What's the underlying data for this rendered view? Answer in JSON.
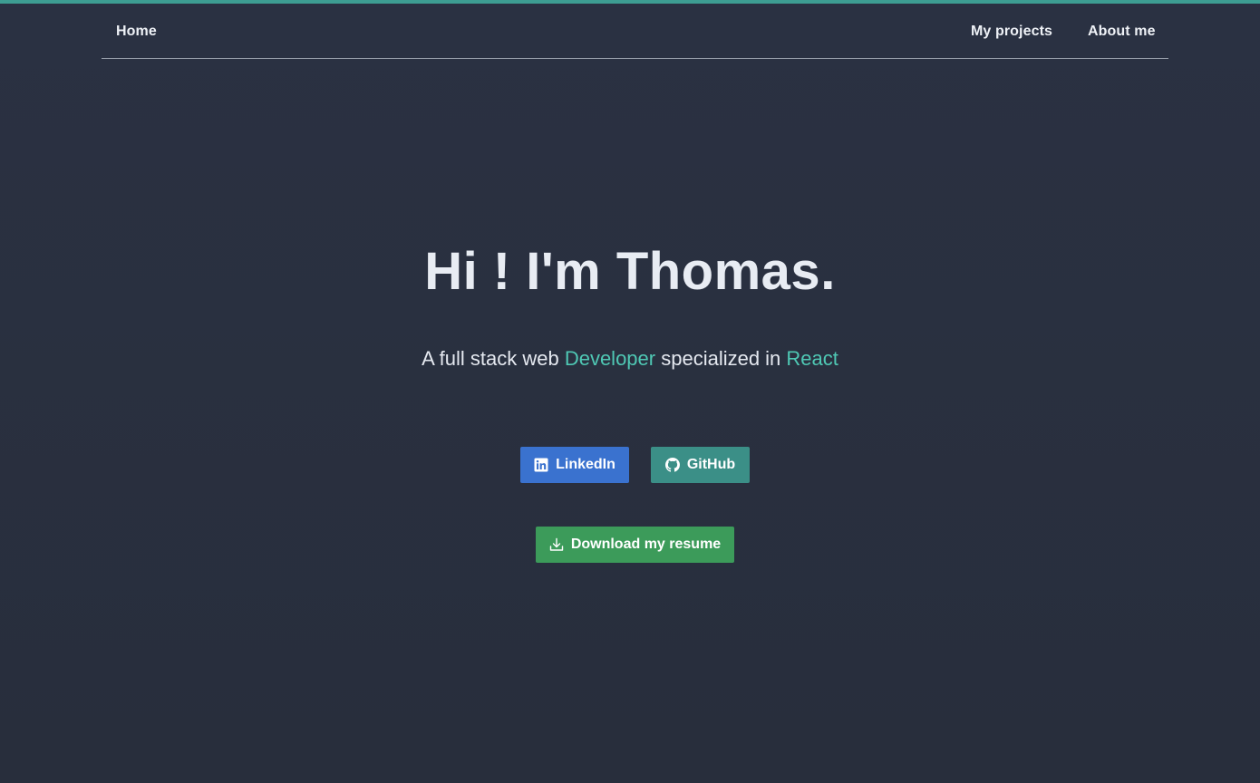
{
  "colors": {
    "background": "#282f3f",
    "accent_bar": "#3d9d92",
    "highlight": "#4fc8b4",
    "linkedin_button": "#3a72cf",
    "github_button": "#3b8f87",
    "resume_button": "#3c9b5a"
  },
  "nav": {
    "home": "Home",
    "projects": "My projects",
    "about": "About me"
  },
  "hero": {
    "title": "Hi ! I'm Thomas.",
    "subtitle_part1": "A full stack web ",
    "subtitle_highlight1": "Developer",
    "subtitle_part2": " specialized in ",
    "subtitle_highlight2": "React"
  },
  "buttons": {
    "linkedin": {
      "label": "LinkedIn",
      "icon": "linkedin-icon"
    },
    "github": {
      "label": "GitHub",
      "icon": "github-icon"
    },
    "resume": {
      "label": "Download my resume",
      "icon": "download-icon"
    }
  }
}
